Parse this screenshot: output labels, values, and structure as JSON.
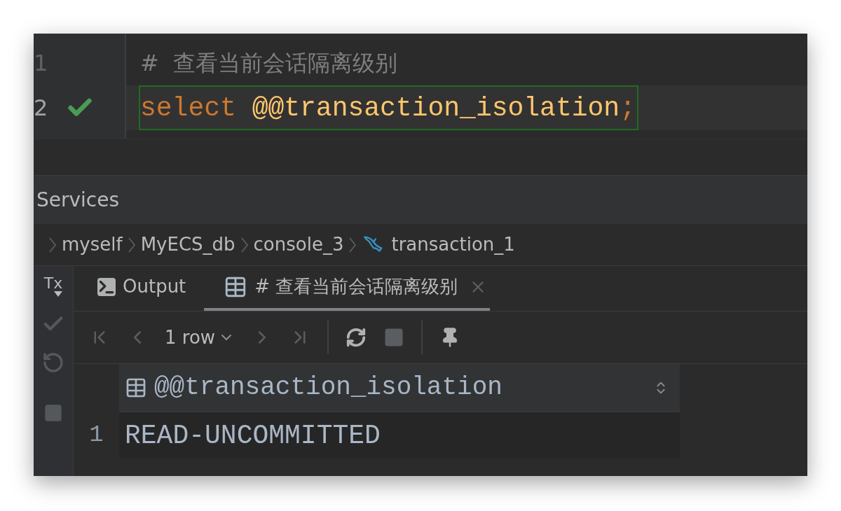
{
  "editor": {
    "lines": [
      {
        "number": "1",
        "kind": "comment",
        "selected": false,
        "executed": false,
        "tokens": [
          {
            "kind": "comment",
            "text": "#  查看当前会话隔离级别"
          }
        ]
      },
      {
        "number": "2",
        "kind": "code",
        "selected": true,
        "executed": true,
        "tokens": [
          {
            "kind": "keyword",
            "text": "select"
          },
          {
            "kind": "variable",
            "text": "@@transaction_isolation"
          },
          {
            "kind": "punct",
            "text": ";"
          }
        ]
      }
    ]
  },
  "services": {
    "title": "Services"
  },
  "breadcrumb": [
    {
      "label": "myself",
      "kind": "plain"
    },
    {
      "label": "MyECS_db",
      "kind": "plain"
    },
    {
      "label": "console_3",
      "kind": "plain"
    },
    {
      "label": "transaction_1",
      "kind": "session"
    }
  ],
  "side_toolbar": [
    {
      "kind": "tx",
      "label": "Tx",
      "disabled": false
    },
    {
      "kind": "commit",
      "disabled": true
    },
    {
      "kind": "rollback",
      "disabled": true
    },
    {
      "kind": "stop",
      "disabled": true
    }
  ],
  "tabs": [
    {
      "kind": "output",
      "label": "Output",
      "selected": false,
      "closable": false
    },
    {
      "kind": "result",
      "label": "# 查看当前会话隔离级别",
      "selected": true,
      "closable": true
    }
  ],
  "toolbar": {
    "row_count": "1 row",
    "buttons": [
      {
        "kind": "first",
        "disabled": true
      },
      {
        "kind": "prev",
        "disabled": true
      },
      {
        "kind": "count"
      },
      {
        "kind": "next",
        "disabled": true
      },
      {
        "kind": "last",
        "disabled": true
      },
      {
        "kind": "sep"
      },
      {
        "kind": "reload",
        "disabled": false
      },
      {
        "kind": "stop",
        "disabled": true
      },
      {
        "kind": "sep"
      },
      {
        "kind": "pin",
        "disabled": false
      }
    ]
  },
  "grid": {
    "columns": [
      "@@transaction_isolation"
    ],
    "rows": [
      {
        "number": "1",
        "cells": [
          "READ-UNCOMMITTED"
        ]
      }
    ]
  }
}
